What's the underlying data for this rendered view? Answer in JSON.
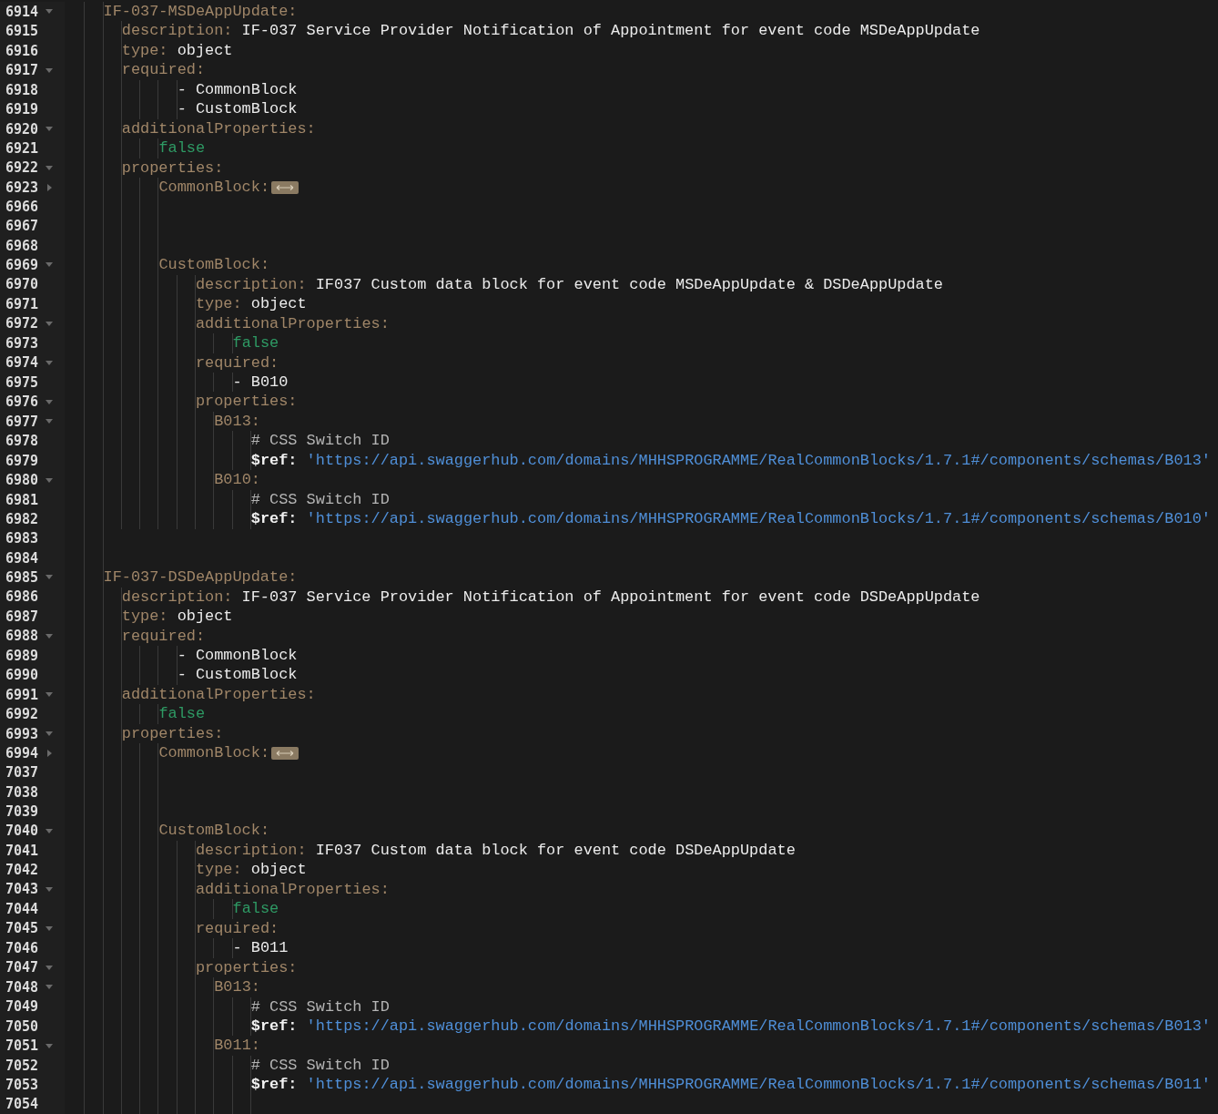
{
  "editor": {
    "lines": [
      {
        "number": "6914",
        "expanded": true,
        "tokens": [
          {
            "kind": "key",
            "text": "    IF-037-MSDeAppUpdate:"
          }
        ]
      },
      {
        "number": "6915",
        "tokens": [
          {
            "kind": "key",
            "text": "      description:"
          },
          {
            "kind": "value",
            "text": "IF-037 Service Provider Notification of Appointment for event code MSDeAppUpdate"
          }
        ]
      },
      {
        "number": "6916",
        "tokens": [
          {
            "kind": "key",
            "text": "      type:"
          },
          {
            "kind": "value",
            "text": "object"
          }
        ]
      },
      {
        "number": "6917",
        "expanded": true,
        "tokens": [
          {
            "kind": "key",
            "text": "      required:"
          }
        ]
      },
      {
        "number": "6918",
        "tokens": [
          {
            "kind": "value",
            "text": "            - CommonBlock"
          }
        ]
      },
      {
        "number": "6919",
        "tokens": [
          {
            "kind": "value",
            "text": "            - CustomBlock"
          }
        ]
      },
      {
        "number": "6920",
        "expanded": true,
        "tokens": [
          {
            "kind": "key",
            "text": "      additionalProperties:"
          }
        ]
      },
      {
        "number": "6921",
        "tokens": [
          {
            "kind": "bool",
            "text": "          false"
          }
        ]
      },
      {
        "number": "6922",
        "expanded": true,
        "tokens": [
          {
            "kind": "key",
            "text": "      properties:"
          }
        ]
      },
      {
        "number": "6923",
        "expanded": false,
        "tokens": [
          {
            "kind": "key",
            "text": "          CommonBlock:"
          },
          {
            "kind": "folded"
          }
        ]
      },
      {
        "number": "6966"
      },
      {
        "number": "6967"
      },
      {
        "number": "6968"
      },
      {
        "number": "6969",
        "expanded": true,
        "tokens": [
          {
            "kind": "key",
            "text": "          CustomBlock:"
          }
        ]
      },
      {
        "number": "6970",
        "tokens": [
          {
            "kind": "key",
            "text": "              description:"
          },
          {
            "kind": "value",
            "text": "IF037 Custom data block for event code MSDeAppUpdate & DSDeAppUpdate"
          }
        ]
      },
      {
        "number": "6971",
        "tokens": [
          {
            "kind": "key",
            "text": "              type:"
          },
          {
            "kind": "value",
            "text": "object"
          }
        ]
      },
      {
        "number": "6972",
        "expanded": true,
        "tokens": [
          {
            "kind": "key",
            "text": "              additionalProperties:"
          }
        ]
      },
      {
        "number": "6973",
        "tokens": [
          {
            "kind": "bool",
            "text": "                  false"
          }
        ]
      },
      {
        "number": "6974",
        "expanded": true,
        "tokens": [
          {
            "kind": "key",
            "text": "              required:"
          }
        ]
      },
      {
        "number": "6975",
        "tokens": [
          {
            "kind": "value",
            "text": "                  - B010"
          }
        ]
      },
      {
        "number": "6976",
        "expanded": true,
        "tokens": [
          {
            "kind": "key",
            "text": "              properties:"
          }
        ]
      },
      {
        "number": "6977",
        "expanded": true,
        "tokens": [
          {
            "kind": "key",
            "text": "                B013:"
          }
        ]
      },
      {
        "number": "6978",
        "tokens": [
          {
            "kind": "comment",
            "text": "                    # CSS Switch ID"
          }
        ]
      },
      {
        "number": "6979",
        "tokens": [
          {
            "kind": "refkey",
            "text": "                    $ref:"
          },
          {
            "kind": "string",
            "text": "'https://api.swaggerhub.com/domains/MHHSPROGRAMME/RealCommonBlocks/1.7.1#/components/schemas/B013'"
          }
        ]
      },
      {
        "number": "6980",
        "expanded": true,
        "tokens": [
          {
            "kind": "key",
            "text": "                B010:"
          }
        ]
      },
      {
        "number": "6981",
        "tokens": [
          {
            "kind": "comment",
            "text": "                    # CSS Switch ID"
          }
        ]
      },
      {
        "number": "6982",
        "tokens": [
          {
            "kind": "refkey",
            "text": "                    $ref:"
          },
          {
            "kind": "string",
            "text": "'https://api.swaggerhub.com/domains/MHHSPROGRAMME/RealCommonBlocks/1.7.1#/components/schemas/B010'"
          }
        ]
      },
      {
        "number": "6983"
      },
      {
        "number": "6984"
      },
      {
        "number": "6985",
        "expanded": true,
        "tokens": [
          {
            "kind": "key",
            "text": "    IF-037-DSDeAppUpdate:"
          }
        ]
      },
      {
        "number": "6986",
        "tokens": [
          {
            "kind": "key",
            "text": "      description:"
          },
          {
            "kind": "value",
            "text": "IF-037 Service Provider Notification of Appointment for event code DSDeAppUpdate"
          }
        ]
      },
      {
        "number": "6987",
        "tokens": [
          {
            "kind": "key",
            "text": "      type:"
          },
          {
            "kind": "value",
            "text": "object"
          }
        ]
      },
      {
        "number": "6988",
        "expanded": true,
        "tokens": [
          {
            "kind": "key",
            "text": "      required:"
          }
        ]
      },
      {
        "number": "6989",
        "tokens": [
          {
            "kind": "value",
            "text": "            - CommonBlock"
          }
        ]
      },
      {
        "number": "6990",
        "tokens": [
          {
            "kind": "value",
            "text": "            - CustomBlock"
          }
        ]
      },
      {
        "number": "6991",
        "expanded": true,
        "tokens": [
          {
            "kind": "key",
            "text": "      additionalProperties:"
          }
        ]
      },
      {
        "number": "6992",
        "tokens": [
          {
            "kind": "bool",
            "text": "          false"
          }
        ]
      },
      {
        "number": "6993",
        "expanded": true,
        "tokens": [
          {
            "kind": "key",
            "text": "      properties:"
          }
        ]
      },
      {
        "number": "6994",
        "expanded": false,
        "tokens": [
          {
            "kind": "key",
            "text": "          CommonBlock:"
          },
          {
            "kind": "folded"
          }
        ]
      },
      {
        "number": "7037"
      },
      {
        "number": "7038"
      },
      {
        "number": "7039"
      },
      {
        "number": "7040",
        "expanded": true,
        "tokens": [
          {
            "kind": "key",
            "text": "          CustomBlock:"
          }
        ]
      },
      {
        "number": "7041",
        "tokens": [
          {
            "kind": "key",
            "text": "              description:"
          },
          {
            "kind": "value",
            "text": "IF037 Custom data block for event code DSDeAppUpdate"
          }
        ]
      },
      {
        "number": "7042",
        "tokens": [
          {
            "kind": "key",
            "text": "              type:"
          },
          {
            "kind": "value",
            "text": "object"
          }
        ]
      },
      {
        "number": "7043",
        "expanded": true,
        "tokens": [
          {
            "kind": "key",
            "text": "              additionalProperties:"
          }
        ]
      },
      {
        "number": "7044",
        "tokens": [
          {
            "kind": "bool",
            "text": "                  false"
          }
        ]
      },
      {
        "number": "7045",
        "expanded": true,
        "tokens": [
          {
            "kind": "key",
            "text": "              required:"
          }
        ]
      },
      {
        "number": "7046",
        "tokens": [
          {
            "kind": "value",
            "text": "                  - B011"
          }
        ]
      },
      {
        "number": "7047",
        "expanded": true,
        "tokens": [
          {
            "kind": "key",
            "text": "              properties:"
          }
        ]
      },
      {
        "number": "7048",
        "expanded": true,
        "tokens": [
          {
            "kind": "key",
            "text": "                B013:"
          }
        ]
      },
      {
        "number": "7049",
        "tokens": [
          {
            "kind": "comment",
            "text": "                    # CSS Switch ID"
          }
        ]
      },
      {
        "number": "7050",
        "tokens": [
          {
            "kind": "refkey",
            "text": "                    $ref:"
          },
          {
            "kind": "string",
            "text": "'https://api.swaggerhub.com/domains/MHHSPROGRAMME/RealCommonBlocks/1.7.1#/components/schemas/B013'"
          }
        ]
      },
      {
        "number": "7051",
        "expanded": true,
        "tokens": [
          {
            "kind": "key",
            "text": "                B011:"
          }
        ]
      },
      {
        "number": "7052",
        "tokens": [
          {
            "kind": "comment",
            "text": "                    # CSS Switch ID"
          }
        ]
      },
      {
        "number": "7053",
        "tokens": [
          {
            "kind": "refkey",
            "text": "                    $ref:"
          },
          {
            "kind": "string",
            "text": "'https://api.swaggerhub.com/domains/MHHSPROGRAMME/RealCommonBlocks/1.7.1#/components/schemas/B011'"
          }
        ]
      },
      {
        "number": "7054"
      }
    ]
  }
}
